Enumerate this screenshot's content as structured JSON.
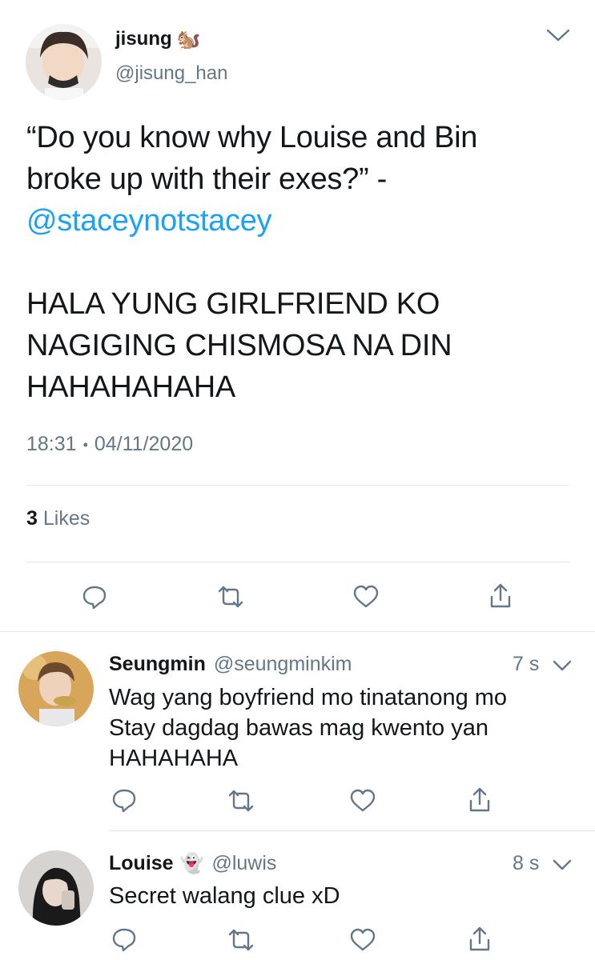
{
  "tweet": {
    "name": "jisung",
    "name_emoji": "🐿️",
    "handle": "@jisung_han",
    "text_line1": "“Do you know why Louise and Bin",
    "text_line2": "broke up with their exes?” -",
    "mention": "@staceynotstacey",
    "caps_line1": "HALA YUNG GIRLFRIEND KO",
    "caps_line2": "NAGIGING CHISMOSA NA DIN",
    "caps_line3": "HAHAHAHAHA",
    "time": "18:31",
    "separator": "•",
    "date": "04/11/2020",
    "likes_count": "3",
    "likes_label": "Likes"
  },
  "replies": [
    {
      "name": "Seungmin",
      "handle": "@seungminkim",
      "time": "7 s",
      "lines": [
        "Wag yang boyfriend mo tinatanong mo",
        "Stay dagdag bawas mag kwento yan",
        "HAHAHAHA"
      ]
    },
    {
      "name": "Louise",
      "name_emoji": "👻",
      "handle": "@luwis",
      "time": "8 s",
      "lines": [
        "Secret walang clue xD"
      ]
    }
  ],
  "icons": {
    "reply": "speech-bubble",
    "retweet": "retweet-arrows",
    "like": "heart",
    "share": "share-arrow-up",
    "menu": "chevron-down"
  },
  "colors": {
    "accent": "#1da1f2",
    "secondary_text": "#657786",
    "divider": "#e1e8ed"
  }
}
